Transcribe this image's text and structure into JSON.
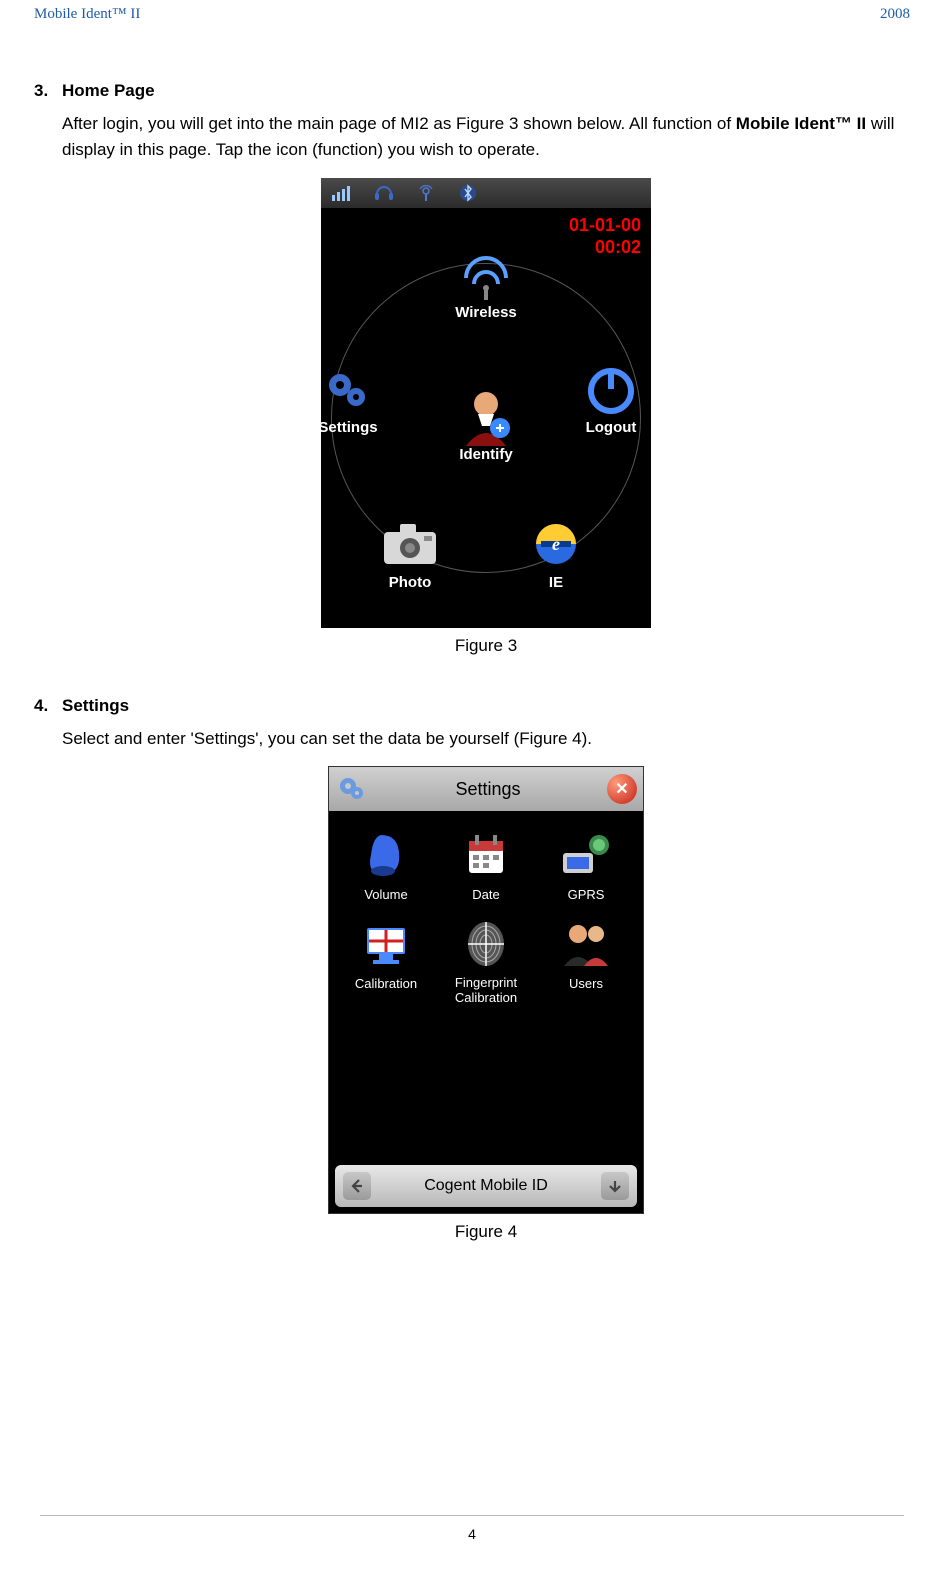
{
  "header": {
    "left": "Mobile Ident™ II",
    "right": "2008"
  },
  "section3": {
    "number": "3.",
    "title": "Home Page",
    "text_before_bold": "After login, you will get into the main page of MI2 as Figure 3 shown below. All function of ",
    "bold": "Mobile Ident™ II",
    "text_after_bold": " will display in this page. Tap the icon (function) you wish to operate.",
    "figure_caption": "Figure 3",
    "device": {
      "date": "01-01-00",
      "time": "00:02",
      "menu": {
        "wireless": "Wireless",
        "settings": "Settings",
        "logout": "Logout",
        "identify": "Identify",
        "photo": "Photo",
        "ie": "IE"
      }
    }
  },
  "section4": {
    "number": "4.",
    "title": "Settings",
    "text": "Select and enter 'Settings', you can set the data be yourself (Figure 4).",
    "figure_caption": "Figure 4",
    "device": {
      "titlebar": {
        "label": "Settings",
        "close": "✕"
      },
      "grid": {
        "volume": "Volume",
        "date": "Date",
        "gprs": "GPRS",
        "calibration": "Calibration",
        "fingerprint": "Fingerprint Calibration",
        "users": "Users"
      },
      "bottombar": {
        "text": "Cogent Mobile ID"
      }
    }
  },
  "footer": {
    "page_number": "4"
  }
}
